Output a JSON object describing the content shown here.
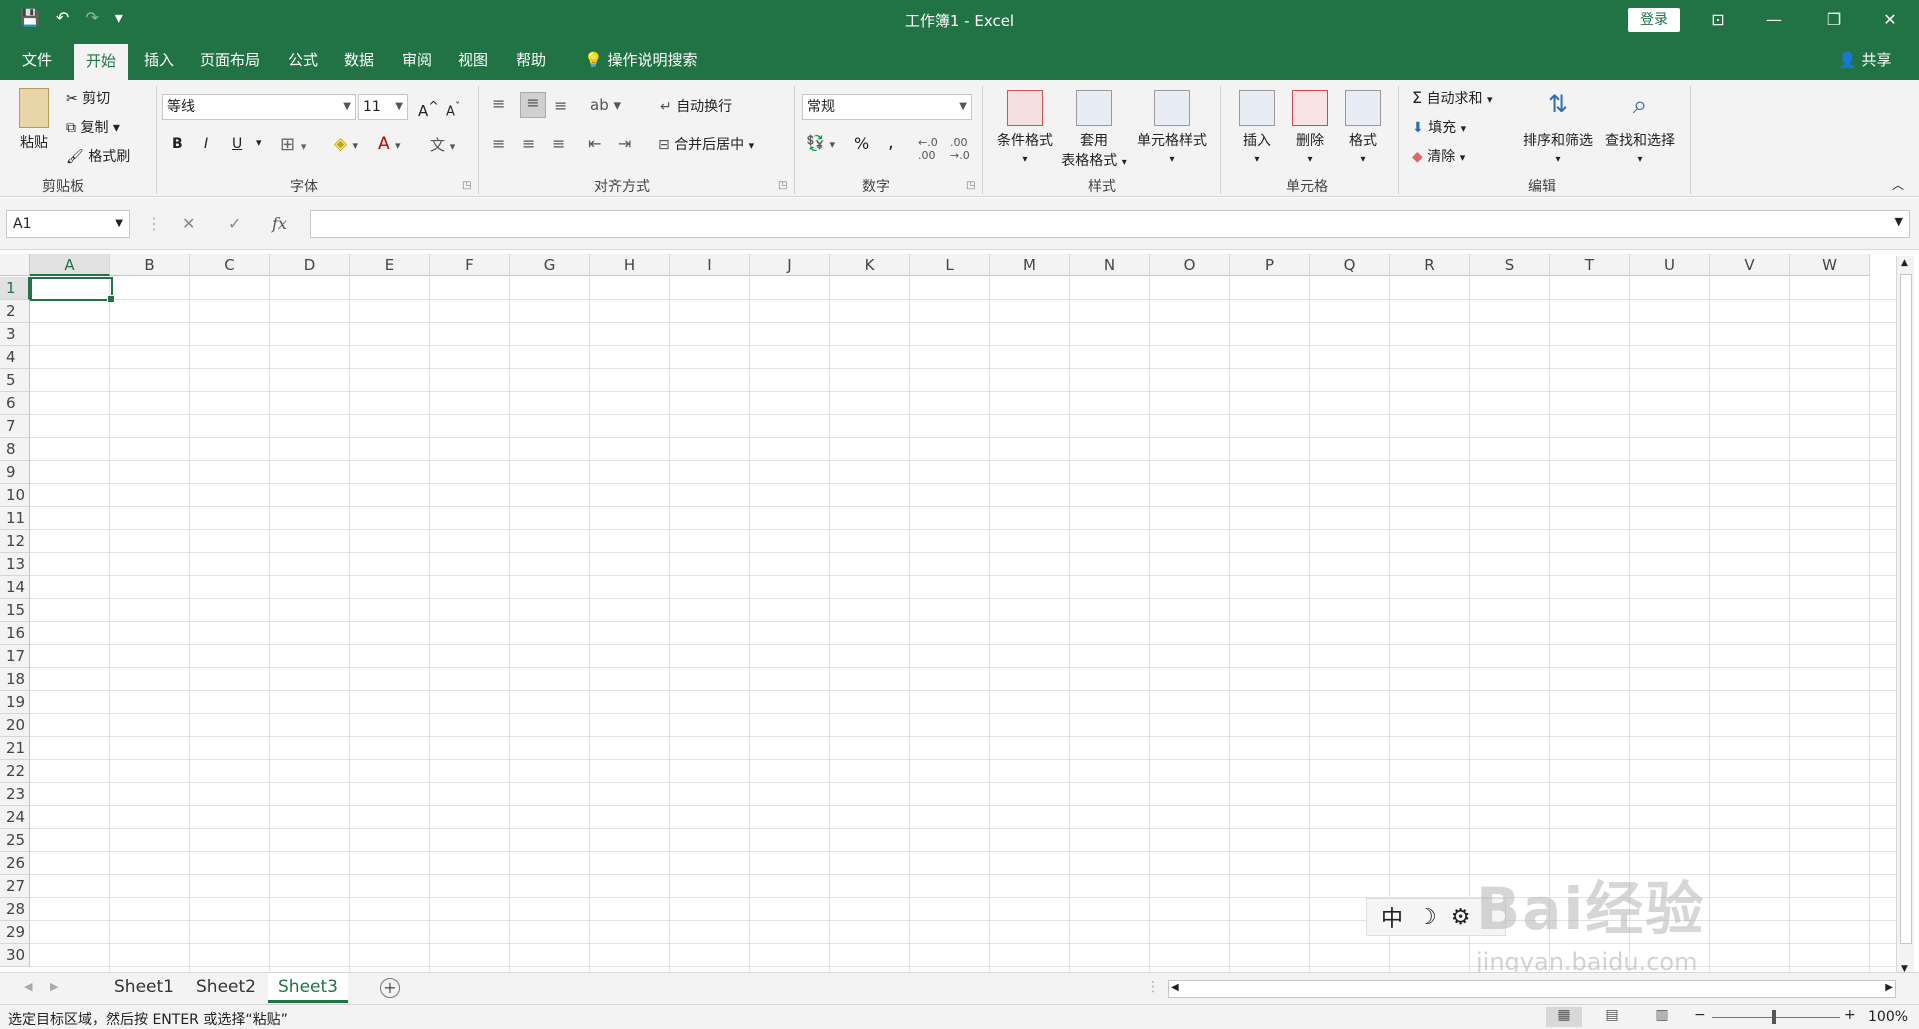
{
  "titlebar": {
    "title": "工作簿1  -  Excel",
    "login": "登录",
    "qat_save": "💾",
    "qat_undo": "↶",
    "qat_redo": "↷",
    "qat_more": "▾",
    "win_ribbon_opts": "⊡",
    "win_min": "—",
    "win_restore": "❐",
    "win_close": "✕"
  },
  "tabs": [
    {
      "label": "文件"
    },
    {
      "label": "开始"
    },
    {
      "label": "插入"
    },
    {
      "label": "页面布局"
    },
    {
      "label": "公式"
    },
    {
      "label": "数据"
    },
    {
      "label": "审阅"
    },
    {
      "label": "视图"
    },
    {
      "label": "帮助"
    },
    {
      "label": "操作说明搜索"
    }
  ],
  "share": "共享",
  "ribbon": {
    "clipboard": {
      "paste": "粘贴",
      "cut": "剪切",
      "copy": "复制",
      "format_painter": "格式刷",
      "label": "剪贴板"
    },
    "font": {
      "name": "等线",
      "size": "11",
      "bold": "B",
      "italic": "I",
      "underline": "U",
      "grow": "A",
      "shrink": "A",
      "label": "字体"
    },
    "alignment": {
      "wrap": "自动换行",
      "merge": "合并后居中",
      "label": "对齐方式"
    },
    "number": {
      "format": "常规",
      "percent": "%",
      "comma": ",",
      "label": "数字"
    },
    "styles": {
      "conditional": "条件格式",
      "table_line1": "套用",
      "table_line2": "表格格式",
      "cell_styles": "单元格样式",
      "label": "样式"
    },
    "cells": {
      "insert": "插入",
      "delete": "删除",
      "format": "格式",
      "label": "单元格"
    },
    "editing": {
      "autosum": "自动求和",
      "fill": "填充",
      "clear": "清除",
      "sort": "排序和筛选",
      "find": "查找和选择",
      "label": "编辑"
    }
  },
  "formula_bar": {
    "name_box": "A1",
    "cancel": "✕",
    "enter": "✓",
    "fx": "fx"
  },
  "columns": [
    "A",
    "B",
    "C",
    "D",
    "E",
    "F",
    "G",
    "H",
    "I",
    "J",
    "K",
    "L",
    "M",
    "N",
    "O",
    "P",
    "Q",
    "R",
    "S",
    "T",
    "U",
    "V",
    "W"
  ],
  "rows": [
    "1",
    "2",
    "3",
    "4",
    "5",
    "6",
    "7",
    "8",
    "9",
    "10",
    "11",
    "12",
    "13",
    "14",
    "15",
    "16",
    "17",
    "18",
    "19",
    "20",
    "21",
    "22",
    "23",
    "24",
    "25",
    "26",
    "27",
    "28",
    "29",
    "30"
  ],
  "sheets": [
    {
      "label": "Sheet1"
    },
    {
      "label": "Sheet2"
    },
    {
      "label": "Sheet3"
    }
  ],
  "status": {
    "text": "选定目标区域，然后按 ENTER 或选择“粘贴”",
    "zoom": "100%"
  },
  "ime": {
    "lang": "中",
    "moon": "☽",
    "gear": "⚙"
  },
  "watermark": {
    "main": "Bai经验",
    "sub": "jingyan.baidu.com"
  },
  "colors": {
    "accent": "#217346",
    "ribbon_bg": "#f3f3f3",
    "grid": "#e2e2e2"
  }
}
